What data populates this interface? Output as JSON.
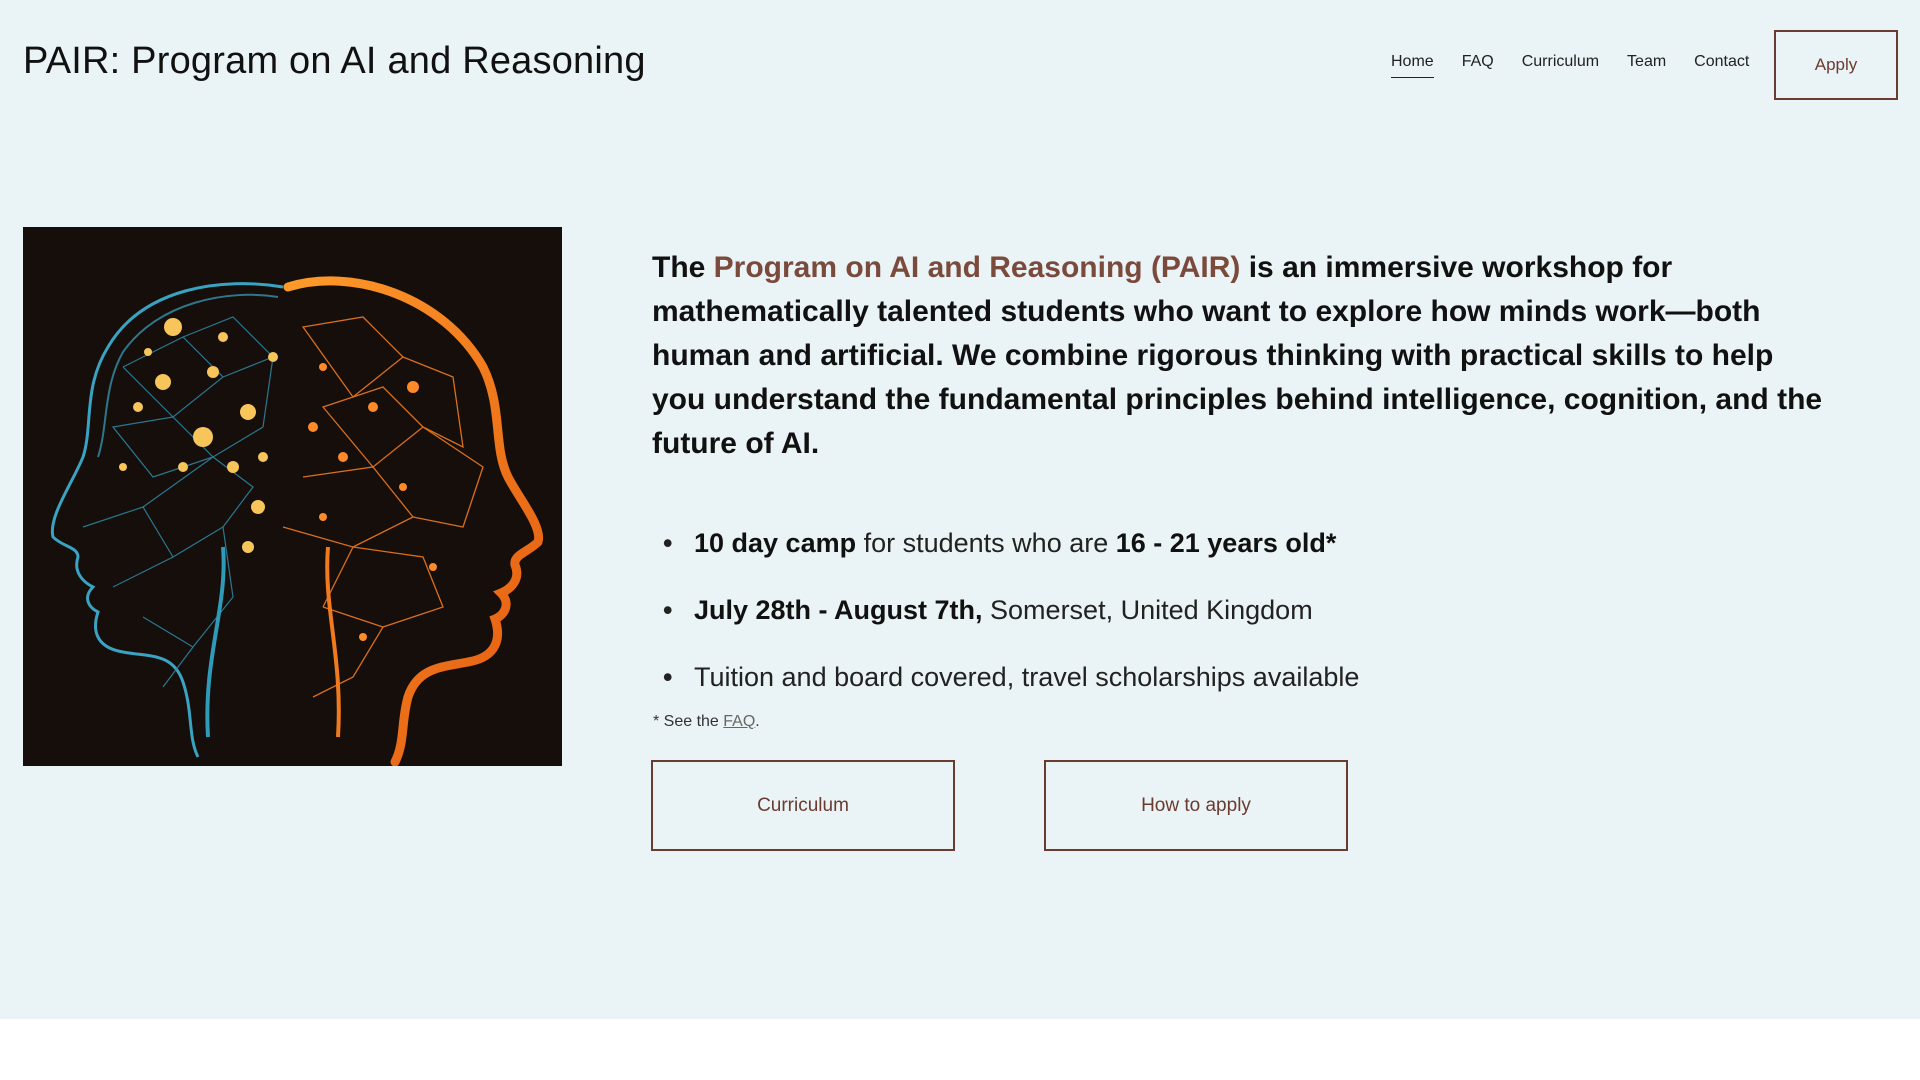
{
  "header": {
    "site_title": "PAIR: Program on AI and Reasoning",
    "nav": [
      {
        "label": "Home",
        "active": true
      },
      {
        "label": "FAQ"
      },
      {
        "label": "Curriculum"
      },
      {
        "label": "Team"
      },
      {
        "label": "Contact"
      }
    ],
    "apply_label": "Apply"
  },
  "hero": {
    "image_alt": "Two head silhouettes facing each other: left in blue with yellow neural nodes, right in orange with branching network lines, on a dark background",
    "intro": {
      "lead": "The ",
      "accent": "Program on AI and Reasoning (PAIR)",
      "rest": " is an immersive workshop for mathematically talented students who want to explore how minds work—both human and artificial. We combine rigorous thinking with practical skills to help you understand the fundamental principles behind intelligence, cognition, and the future of AI."
    },
    "bullets": [
      {
        "b1": "10 day camp",
        "t1": " for students who are ",
        "b2": "16 - 21 years old*"
      },
      {
        "b1": " July 28th - August 7th,",
        "t1": " Somerset, United Kingdom"
      },
      {
        "t1": "Tuition and board covered, travel scholarships available"
      }
    ],
    "bullet_char": "•",
    "footnote": {
      "prefix": "* See the ",
      "link": "FAQ",
      "suffix": "."
    },
    "buttons": {
      "curriculum": "Curriculum",
      "how_to_apply": "How to apply"
    }
  },
  "colors": {
    "background": "#eaf3f5",
    "accent": "#7a4a3c",
    "button_border": "#6b3b2f",
    "image_bg": "#150e0b"
  }
}
